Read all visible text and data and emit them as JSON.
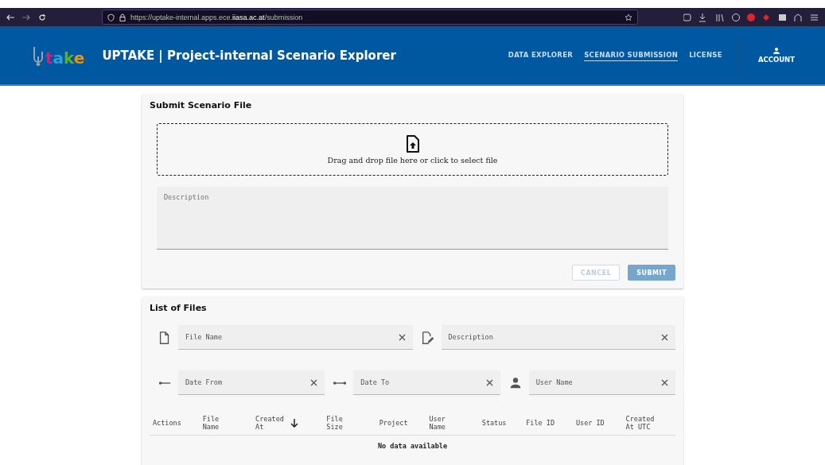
{
  "browser": {
    "url": "https://uptake-internal.apps.ece.**iiasa.ac.at**/submission"
  },
  "header": {
    "logo": [
      {
        "text": "t",
        "color": "#e5157a"
      },
      {
        "text": "a",
        "color": "#2aa3dc"
      },
      {
        "text": "k",
        "color": "#5db02f"
      },
      {
        "text": "e",
        "color": "#f39200"
      }
    ],
    "title": "UPTAKE | Project-internal Scenario Explorer",
    "nav": [
      {
        "label": "DATA EXPLORER",
        "selected": false
      },
      {
        "label": "SCENARIO SUBMISSION",
        "selected": true
      },
      {
        "label": "LICENSE",
        "selected": false
      }
    ],
    "account": "ACCOUNT"
  },
  "submit_card": {
    "title": "Submit Scenario File",
    "dropzone": "Drag and drop file here or click to select file",
    "description": {
      "placeholder": "Description"
    },
    "buttons": [
      {
        "label": "CANCEL",
        "kind": "outline",
        "disabled": true
      },
      {
        "label": "SUBMIT",
        "kind": "filled",
        "disabled": true
      }
    ]
  },
  "files_card": {
    "title": "List of Files",
    "filter_rows": [
      [
        {
          "placeholder": "File Name"
        },
        {
          "placeholder": "Description"
        }
      ],
      [
        {
          "placeholder": "Date From"
        },
        {
          "placeholder": "Date To"
        },
        {
          "placeholder": "User Name"
        }
      ]
    ],
    "table": {
      "columns": [
        {
          "label": "Actions",
          "sorted": false
        },
        {
          "label": "File Name",
          "sorted": false
        },
        {
          "label": "Created At",
          "sorted": true
        },
        {
          "label": "File Size",
          "sorted": false
        },
        {
          "label": "Project",
          "sorted": false
        },
        {
          "label": "User Name",
          "sorted": false
        },
        {
          "label": "Status",
          "sorted": false
        },
        {
          "label": "File ID",
          "sorted": false
        },
        {
          "label": "User ID",
          "sorted": false
        },
        {
          "label": "Created At UTC",
          "sorted": false
        }
      ],
      "empty": "No data available"
    }
  }
}
